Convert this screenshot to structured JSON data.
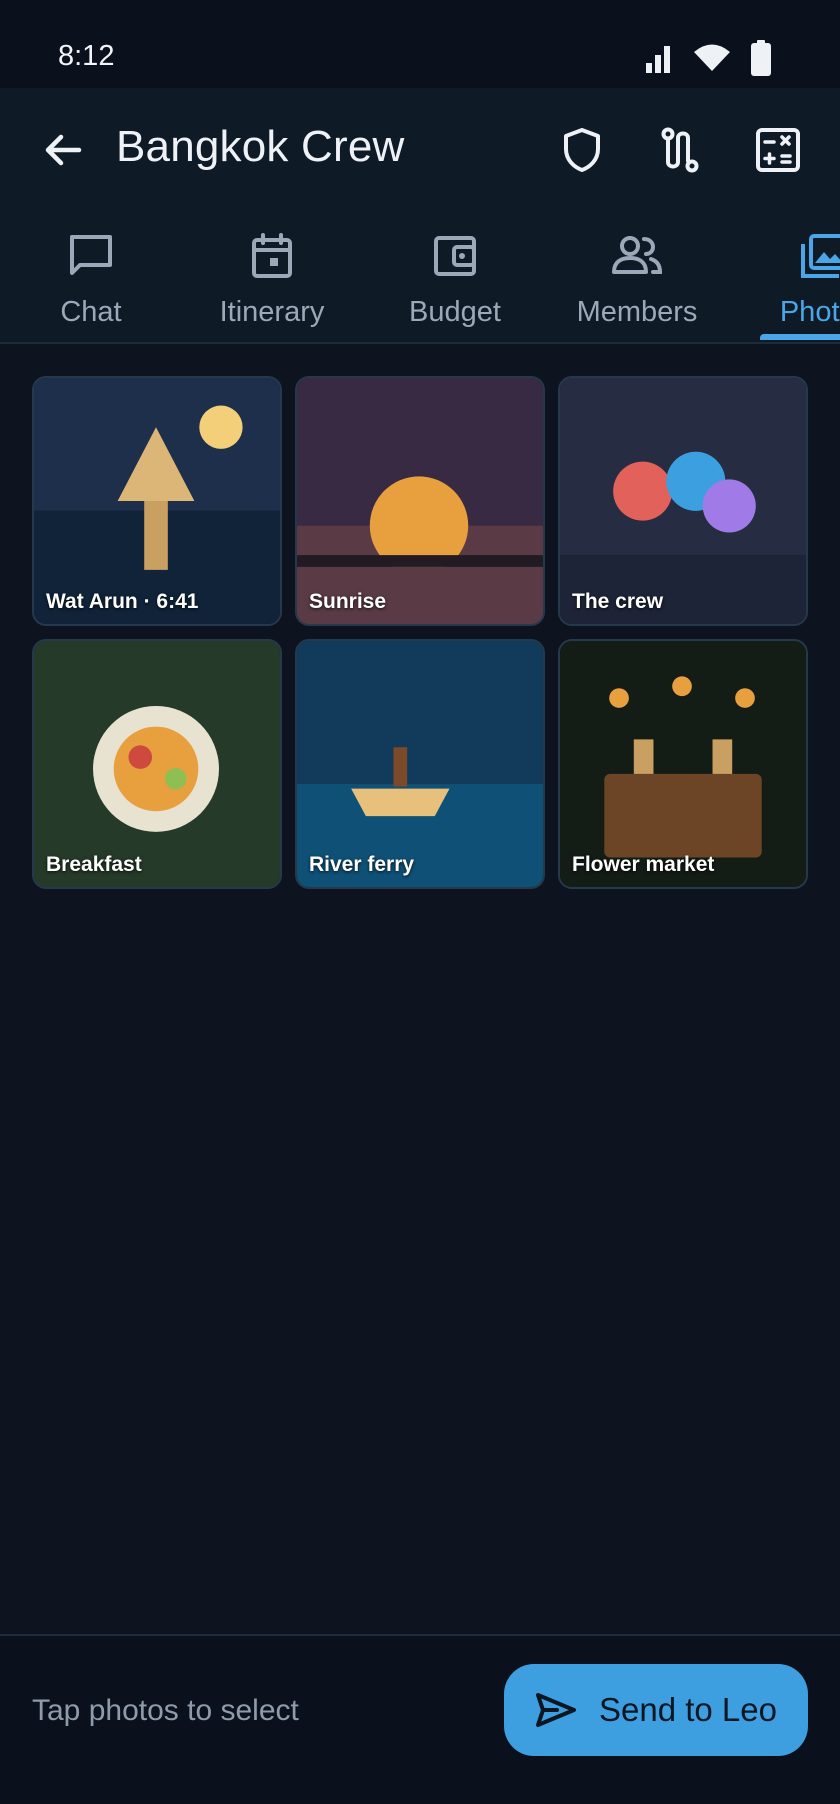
{
  "status": {
    "time": "8:12",
    "icons": [
      "signal-icon",
      "wifi-icon",
      "battery-icon"
    ]
  },
  "appbar": {
    "title": "Bangkok Crew",
    "actions": [
      "shield-icon",
      "route-icon",
      "calculator-icon"
    ]
  },
  "tabs": [
    {
      "label": "Chat",
      "icon": "chat-icon",
      "active": false
    },
    {
      "label": "Itinerary",
      "icon": "calendar-icon",
      "active": false
    },
    {
      "label": "Budget",
      "icon": "wallet-icon",
      "active": false
    },
    {
      "label": "Members",
      "icon": "people-icon",
      "active": false
    },
    {
      "label": "Photos",
      "icon": "photos-icon",
      "active": true
    }
  ],
  "photos": [
    {
      "caption": "Wat Arun · 6:41"
    },
    {
      "caption": "Sunrise"
    },
    {
      "caption": "The crew"
    },
    {
      "caption": "Breakfast"
    },
    {
      "caption": "River ferry"
    },
    {
      "caption": "Flower market"
    }
  ],
  "bottom": {
    "hint": "Tap photos to select",
    "send_label": "Send to Leo"
  },
  "colors": {
    "accent": "#4aa6e6",
    "button": "#3d9fe0",
    "background": "#0d1420"
  }
}
